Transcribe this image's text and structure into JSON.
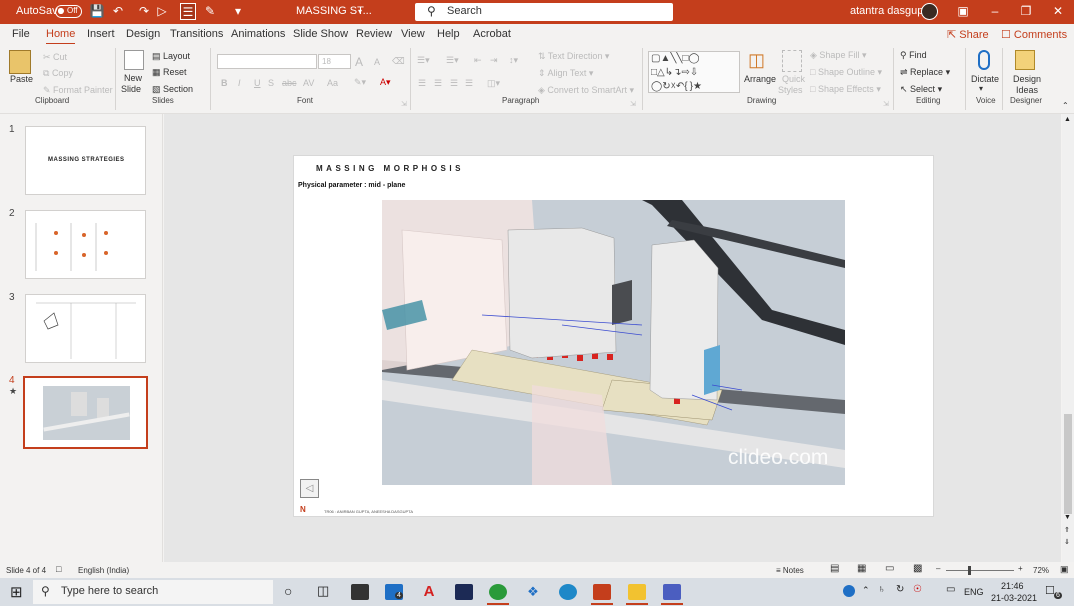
{
  "titlebar": {
    "autosave": "AutoSave",
    "autosave_state": "Off",
    "doc_title": "MASSING ST...",
    "search_placeholder": "Search",
    "user": "atantra dasgupta"
  },
  "menu": [
    "File",
    "Home",
    "Insert",
    "Design",
    "Transitions",
    "Animations",
    "Slide Show",
    "Review",
    "View",
    "Help",
    "Acrobat"
  ],
  "menu_active": "Home",
  "share": "Share",
  "comments": "Comments",
  "ribbon": {
    "clipboard": {
      "paste": "Paste",
      "cut": "Cut",
      "copy": "Copy",
      "format_painter": "Format Painter",
      "label": "Clipboard"
    },
    "slides": {
      "new_slide": "New",
      "new_slide2": "Slide",
      "layout": "Layout",
      "reset": "Reset",
      "section": "Section",
      "label": "Slides"
    },
    "font": {
      "label": "Font",
      "size": "18",
      "bold": "B",
      "italic": "I",
      "underline": "U",
      "strike": "S",
      "shadow": "abc",
      "spacing": "AV",
      "case": "Aa",
      "grow": "A",
      "shrink": "A"
    },
    "paragraph": {
      "label": "Paragraph",
      "text_direction": "Text Direction",
      "align_text": "Align Text",
      "convert": "Convert to SmartArt"
    },
    "drawing": {
      "label": "Drawing",
      "arrange": "Arrange",
      "quick_styles": "Quick",
      "quick_styles2": "Styles",
      "shape_fill": "Shape Fill",
      "shape_outline": "Shape Outline",
      "shape_effects": "Shape Effects"
    },
    "editing": {
      "label": "Editing",
      "find": "Find",
      "replace": "Replace",
      "select": "Select"
    },
    "voice": {
      "label": "Voice",
      "dictate": "Dictate"
    },
    "designer": {
      "label": "Designer",
      "design_ideas": "Design",
      "design_ideas2": "Ideas"
    }
  },
  "slides": [
    {
      "num": "1",
      "title": "MASSING STRATEGIES"
    },
    {
      "num": "2"
    },
    {
      "num": "3"
    },
    {
      "num": "4"
    }
  ],
  "slide": {
    "title": "MASSING MORPHOSIS",
    "subtitle": "Physical parameter : mid - plane",
    "watermark": "clideo.com",
    "footer": "TR06 : ANIRBAN GUPTA, ANEESHA DASGUPTA",
    "logo": "N"
  },
  "status": {
    "slide_count": "Slide 4 of 4",
    "language": "English (India)",
    "notes": "Notes",
    "zoom": "72%"
  },
  "taskbar": {
    "search_placeholder": "Type here to search",
    "lang": "ENG",
    "time": "21:46",
    "date": "21-03-2021",
    "mail_badge": "4",
    "notif_badge": "6"
  },
  "colors": {
    "accent": "#c43e1c",
    "taskbar": "#d9dee4",
    "ribbon": "#f3f2f1"
  }
}
